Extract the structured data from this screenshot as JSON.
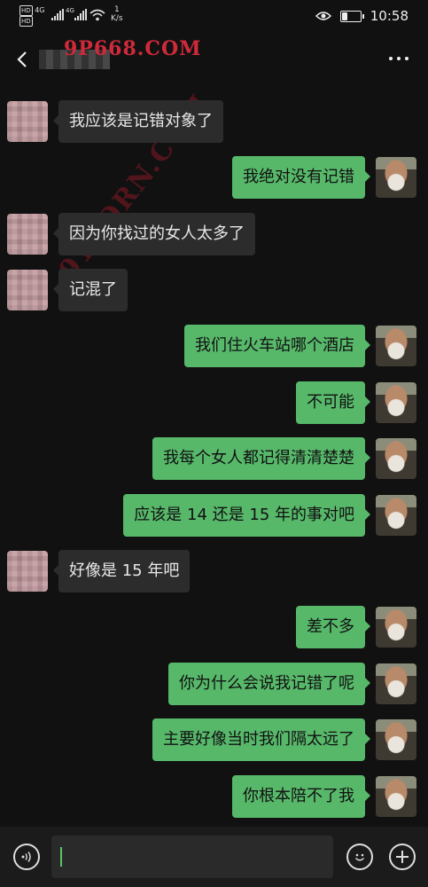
{
  "status_bar": {
    "hd1": "HD",
    "net1": "4G",
    "hd2": "HD",
    "net2": "4G",
    "speed_value": "1",
    "speed_unit": "K/s",
    "time": "10:58",
    "battery_level": 0.35,
    "icons": [
      "eye-icon",
      "battery-icon",
      "signal-icon",
      "wifi-icon"
    ]
  },
  "header": {
    "watermark": "9P668.COM",
    "diagonal_watermark": "91PORN.COM",
    "icons": [
      "back-icon",
      "more-icon"
    ]
  },
  "messages": [
    {
      "side": "recv",
      "text": "我应该是记错对象了"
    },
    {
      "side": "sent",
      "text": "我绝对没有记错"
    },
    {
      "side": "recv",
      "text": "因为你找过的女人太多了"
    },
    {
      "side": "recv",
      "text": "记混了"
    },
    {
      "side": "sent",
      "text": "我们住火车站哪个酒店"
    },
    {
      "side": "sent",
      "text": "不可能"
    },
    {
      "side": "sent",
      "text": "我每个女人都记得清清楚楚"
    },
    {
      "side": "sent",
      "text": "应该是 14 还是 15 年的事对吧"
    },
    {
      "side": "recv",
      "text": "好像是 15 年吧"
    },
    {
      "side": "sent",
      "text": "差不多"
    },
    {
      "side": "sent",
      "text": "你为什么会说我记错了呢"
    },
    {
      "side": "sent",
      "text": "主要好像当时我们隔太远了"
    },
    {
      "side": "sent",
      "text": "你根本陪不了我"
    }
  ],
  "input_bar": {
    "voice_icon": "voice-icon",
    "emoji_icon": "emoji-icon",
    "plus_icon": "plus-icon",
    "accent": "#57c76a"
  },
  "colors": {
    "background": "#111111",
    "sent_bubble": "#57b86a",
    "recv_bubble": "#2c2c2c",
    "watermark": "#d02a3a"
  }
}
